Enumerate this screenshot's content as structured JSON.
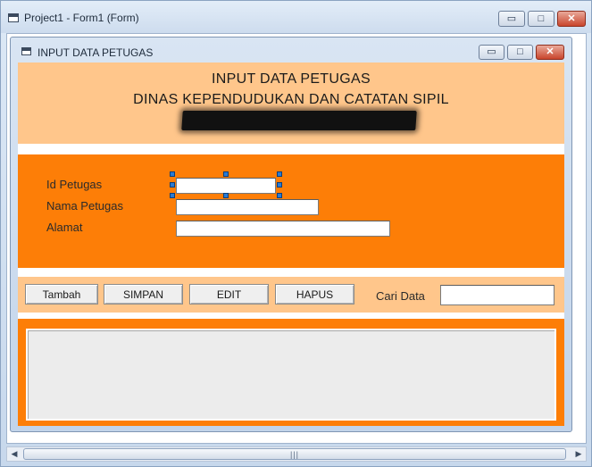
{
  "ide_window": {
    "title": "Project1 - Form1 (Form)",
    "buttons": {
      "minimize": "▭",
      "maximize": "□",
      "close": "✕"
    }
  },
  "form_window": {
    "title": "INPUT DATA PETUGAS",
    "buttons": {
      "minimize": "▭",
      "maximize": "□",
      "close": "✕"
    }
  },
  "header": {
    "line1": "INPUT DATA PETUGAS",
    "line2": "DINAS KEPENDUDUKAN DAN CATATAN SIPIL"
  },
  "fields": {
    "id_label": "Id Petugas",
    "id_value": "",
    "nama_label": "Nama Petugas",
    "nama_value": "",
    "alamat_label": "Alamat",
    "alamat_value": ""
  },
  "buttons": {
    "tambah": "Tambah",
    "simpan": "SIMPAN",
    "edit": "EDIT",
    "hapus": "HAPUS"
  },
  "search": {
    "label": "Cari Data",
    "value": ""
  },
  "scrollbar": {
    "left_arrow": "◀",
    "right_arrow": "▶",
    "grip": "|||"
  },
  "colors": {
    "header_panel": "#ffc68b",
    "input_panel": "#fd7e07",
    "selection_handle": "#2a7bd4"
  }
}
